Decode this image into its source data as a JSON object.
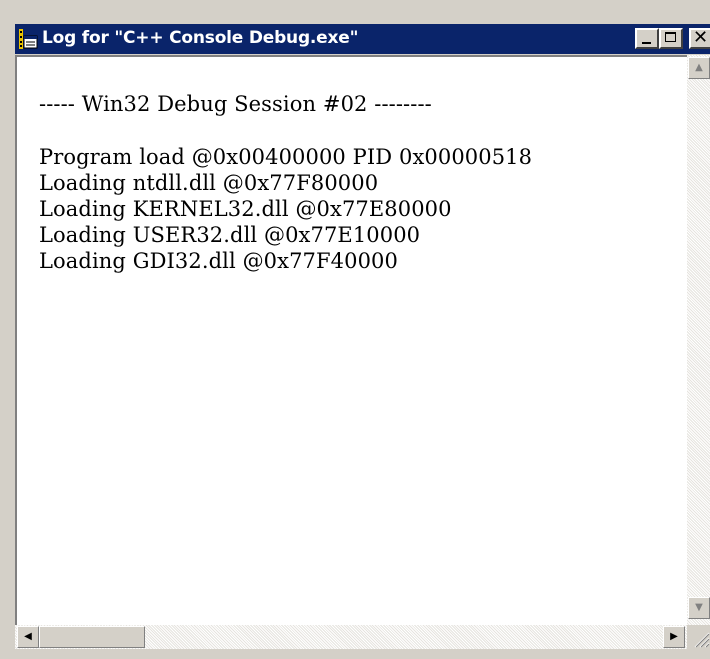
{
  "window": {
    "title": "Log for \"C++ Console Debug.exe\"",
    "icon": "notepad-log-icon"
  },
  "caption_buttons": {
    "minimize": "minimize-icon",
    "maximize": "maximize-icon",
    "close_glyph": "✕"
  },
  "log": {
    "lines": [
      "----- Win32 Debug Session #02 --------",
      "Program load @0x00400000 PID 0x00000518",
      "Loading ntdll.dll @0x77F80000",
      "Loading KERNEL32.dll @0x77E80000",
      "Loading USER32.dll @0x77E10000",
      "Loading GDI32.dll @0x77F40000"
    ]
  },
  "scrollbars": {
    "up_arrow": "▲",
    "down_arrow": "▼",
    "left_arrow": "◀",
    "right_arrow": "▶"
  },
  "colors": {
    "titlebar": "#0a246a",
    "face": "#d4d0c8",
    "editor_bg": "#ffffff"
  }
}
